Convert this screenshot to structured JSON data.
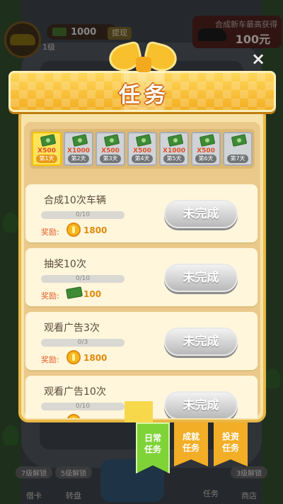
{
  "header": {
    "cash": "1000",
    "level": "1级",
    "withdraw": "提现",
    "promo_title": "合成新车最高获得",
    "promo_amount": "100元"
  },
  "dialog": {
    "title": "任务",
    "close": "×"
  },
  "days": [
    {
      "mult": "X500",
      "label": "第1天",
      "active": true
    },
    {
      "mult": "X1000",
      "label": "第2天"
    },
    {
      "mult": "X500",
      "label": "第3天"
    },
    {
      "mult": "X500",
      "label": "第4天"
    },
    {
      "mult": "X1000",
      "label": "第5天"
    },
    {
      "mult": "X500",
      "label": "第6天"
    },
    {
      "mult": "",
      "label": "第7天"
    }
  ],
  "tasks": [
    {
      "title": "合成10次车辆",
      "progress": "0/10",
      "progress_value": 0,
      "reward_label": "奖励:",
      "reward_icon": "coin-icon",
      "reward": "1800",
      "button": "未完成"
    },
    {
      "title": "抽奖10次",
      "progress": "0/10",
      "progress_value": 0,
      "reward_label": "奖励:",
      "reward_icon": "cash-icon",
      "reward": "100",
      "button": "未完成"
    },
    {
      "title": "观看广告3次",
      "progress": "0/3",
      "progress_value": 0,
      "reward_label": "奖励:",
      "reward_icon": "coin-icon",
      "reward": "1800",
      "button": "未完成"
    },
    {
      "title": "观看广告10次",
      "progress": "0/10",
      "progress_value": 0,
      "reward_label": "奖励:",
      "reward_icon": "coin-icon",
      "reward": "",
      "button": "未完成"
    }
  ],
  "tabs": [
    {
      "line1": "日常",
      "line2": "任务",
      "active": true
    },
    {
      "line1": "成就",
      "line2": "任务"
    },
    {
      "line1": "投资",
      "line2": "任务"
    }
  ],
  "bottom": {
    "item1_badge": "7级解锁",
    "item1_label": "借卡",
    "item2_badge": "5级解锁",
    "item2_label": "转盘",
    "item3_label": "任务",
    "item4_badge": "3级解锁",
    "item4_label": "商店"
  },
  "colors": {
    "banner": "#f3ae22",
    "panel": "#f7e3a8",
    "active_tab": "#7fd337",
    "inactive_tab": "#f2ae26",
    "incomplete_button": "#b9b9b9"
  }
}
